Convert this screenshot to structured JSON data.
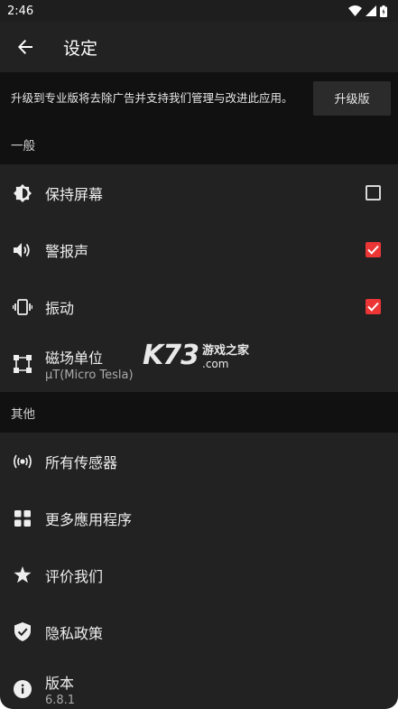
{
  "status_bar": {
    "time": "2:46"
  },
  "app_bar": {
    "title": "设定"
  },
  "upgrade": {
    "text": "升级到专业版将去除广告并支持我们管理与改进此应用。",
    "button": "升级版"
  },
  "sections": {
    "general": "一般",
    "other": "其他"
  },
  "general_items": [
    {
      "label": "保持屏幕",
      "icon": "brightness-icon",
      "checked": false
    },
    {
      "label": "警报声",
      "icon": "volume-icon",
      "checked": true
    },
    {
      "label": "振动",
      "icon": "vibrate-icon",
      "checked": true
    },
    {
      "label": "磁场单位",
      "sub": "μT(Micro Tesla)",
      "icon": "units-icon"
    }
  ],
  "other_items": [
    {
      "label": "所有传感器",
      "icon": "sensor-icon"
    },
    {
      "label": "更多應用程序",
      "icon": "apps-grid-icon"
    },
    {
      "label": "评价我们",
      "icon": "star-icon"
    },
    {
      "label": "隐私政策",
      "icon": "shield-check-icon"
    },
    {
      "label": "版本",
      "sub": "6.8.1",
      "icon": "info-icon"
    }
  ],
  "watermark": {
    "brand": "K73",
    "cn": "游戏之家",
    "domain": ".com"
  },
  "colors": {
    "accent": "#ec3535",
    "background": "#222222",
    "header_bg": "#111111"
  }
}
